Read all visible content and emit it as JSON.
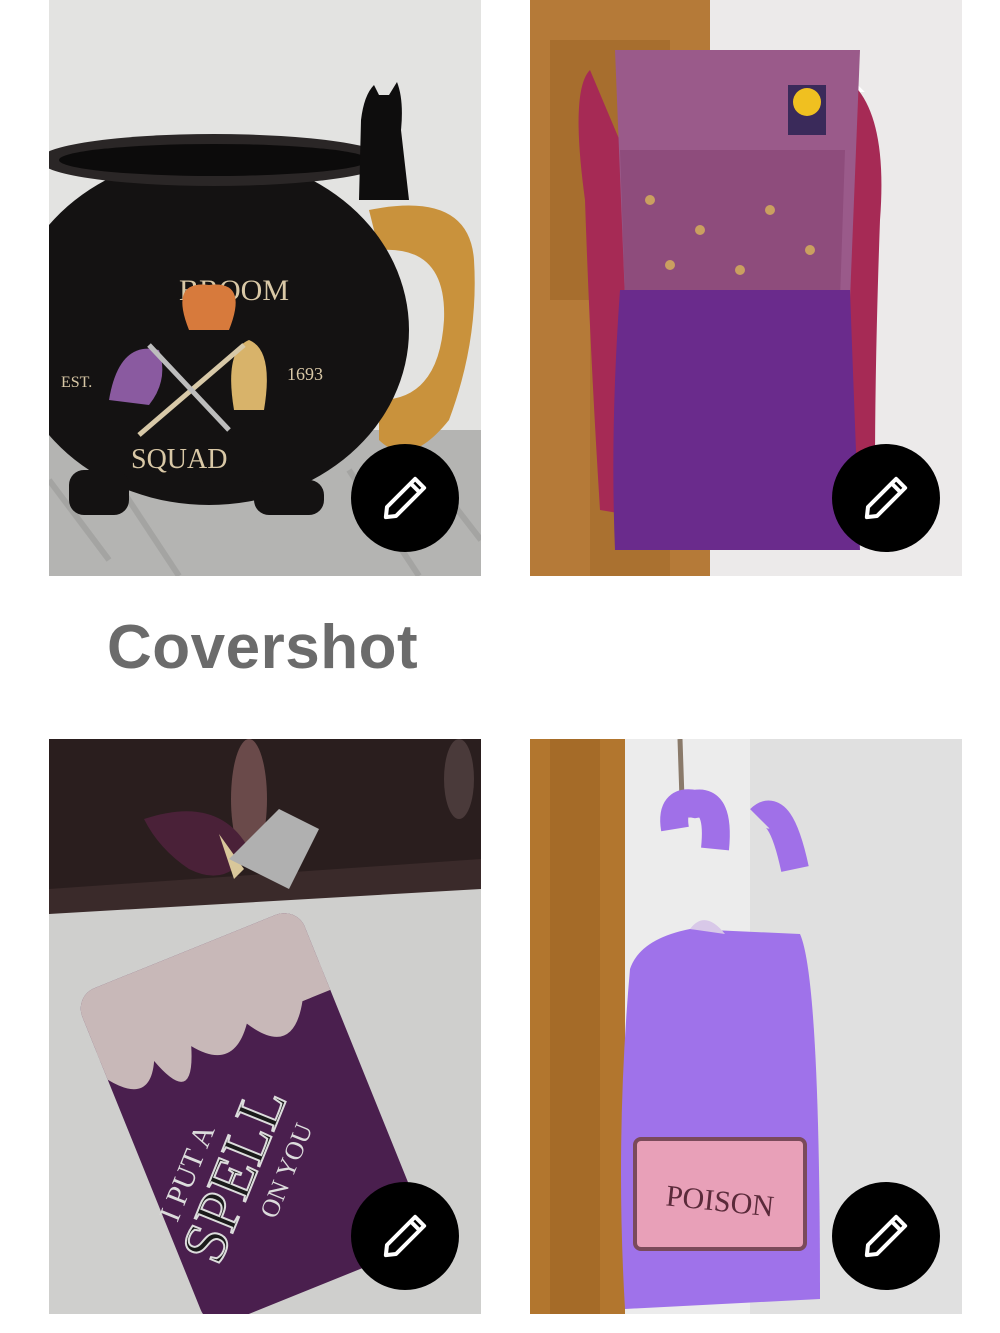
{
  "section_title": "Covershot",
  "photos": [
    {
      "subject": "Black cauldron mug",
      "texts": [
        "BROOM",
        "SQUAD",
        "EST.",
        "1693"
      ]
    },
    {
      "subject": "Purple lace-up costume top on hanger",
      "texts": []
    },
    {
      "subject": "Purple zip wallet",
      "texts": [
        "I PUT A",
        "SPELL",
        "ON YOU"
      ]
    },
    {
      "subject": "Purple fuzzy tote bag",
      "texts": [
        "POISON"
      ]
    }
  ],
  "edit_icon": "pencil-icon",
  "colors": {
    "title": "#6b6b6b",
    "edit_button_bg": "#000000",
    "edit_icon": "#ffffff"
  }
}
